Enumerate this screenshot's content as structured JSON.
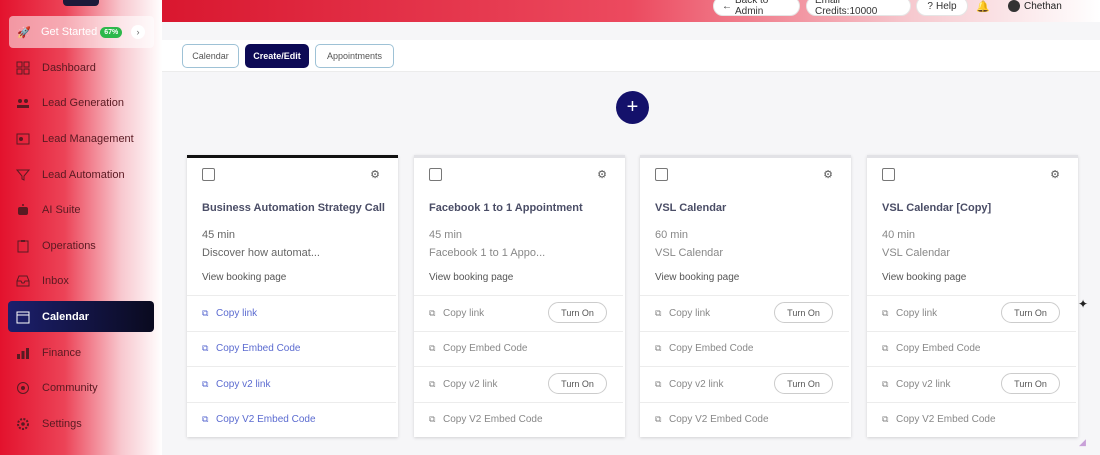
{
  "sidebar": {
    "get_started": {
      "label": "Get Started",
      "badge": "67%",
      "icon": "rocket-icon"
    },
    "items": [
      {
        "label": "Dashboard",
        "icon": "dashboard-icon",
        "active": false
      },
      {
        "label": "Lead Generation",
        "icon": "people-icon",
        "active": false
      },
      {
        "label": "Lead Management",
        "icon": "contact-card-icon",
        "active": false
      },
      {
        "label": "Lead Automation",
        "icon": "filter-icon",
        "active": false
      },
      {
        "label": "AI Suite",
        "icon": "robot-icon",
        "active": false
      },
      {
        "label": "Operations",
        "icon": "clipboard-icon",
        "active": false
      },
      {
        "label": "Inbox",
        "icon": "inbox-icon",
        "active": false
      },
      {
        "label": "Calendar",
        "icon": "calendar-icon",
        "active": true
      },
      {
        "label": "Finance",
        "icon": "chart-icon",
        "active": false
      },
      {
        "label": "Community",
        "icon": "community-icon",
        "active": false
      },
      {
        "label": "Settings",
        "icon": "gear-icon",
        "active": false
      }
    ]
  },
  "header": {
    "back_label": "Back to Admin",
    "email_credits": "Email Credits:10000",
    "help_label": "Help",
    "user_name": "Chethan"
  },
  "tabs": [
    {
      "label": "Calendar",
      "active": false
    },
    {
      "label": "Create/Edit",
      "active": true
    },
    {
      "label": "Appointments",
      "active": false
    }
  ],
  "add_button": "+",
  "cards": [
    {
      "title": "Business Automation Strategy Call",
      "duration": "45 min",
      "description": "Discover how automat...",
      "view_link": "View booking page",
      "enabled": true,
      "actions": {
        "copy_link": "Copy link",
        "copy_embed": "Copy Embed Code",
        "copy_v2_link": "Copy v2 link",
        "copy_v2_embed": "Copy V2 Embed Code"
      },
      "toggle_label": ""
    },
    {
      "title": "Facebook 1 to 1 Appointment",
      "duration": "45 min",
      "description": "Facebook 1 to 1 Appo...",
      "view_link": "View booking page",
      "enabled": false,
      "actions": {
        "copy_link": "Copy link",
        "copy_embed": "Copy Embed Code",
        "copy_v2_link": "Copy v2 link",
        "copy_v2_embed": "Copy V2 Embed Code"
      },
      "toggle_label": "Turn On"
    },
    {
      "title": "VSL Calendar",
      "duration": "60 min",
      "description": "VSL Calendar",
      "view_link": "View booking page",
      "enabled": false,
      "actions": {
        "copy_link": "Copy link",
        "copy_embed": "Copy Embed Code",
        "copy_v2_link": "Copy v2 link",
        "copy_v2_embed": "Copy V2 Embed Code"
      },
      "toggle_label": "Turn On"
    },
    {
      "title": "VSL Calendar [Copy]",
      "duration": "40 min",
      "description": "VSL Calendar",
      "view_link": "View booking page",
      "enabled": false,
      "actions": {
        "copy_link": "Copy link",
        "copy_embed": "Copy Embed Code",
        "copy_v2_link": "Copy v2 link",
        "copy_v2_embed": "Copy V2 Embed Code"
      },
      "toggle_label": "Turn On"
    }
  ]
}
